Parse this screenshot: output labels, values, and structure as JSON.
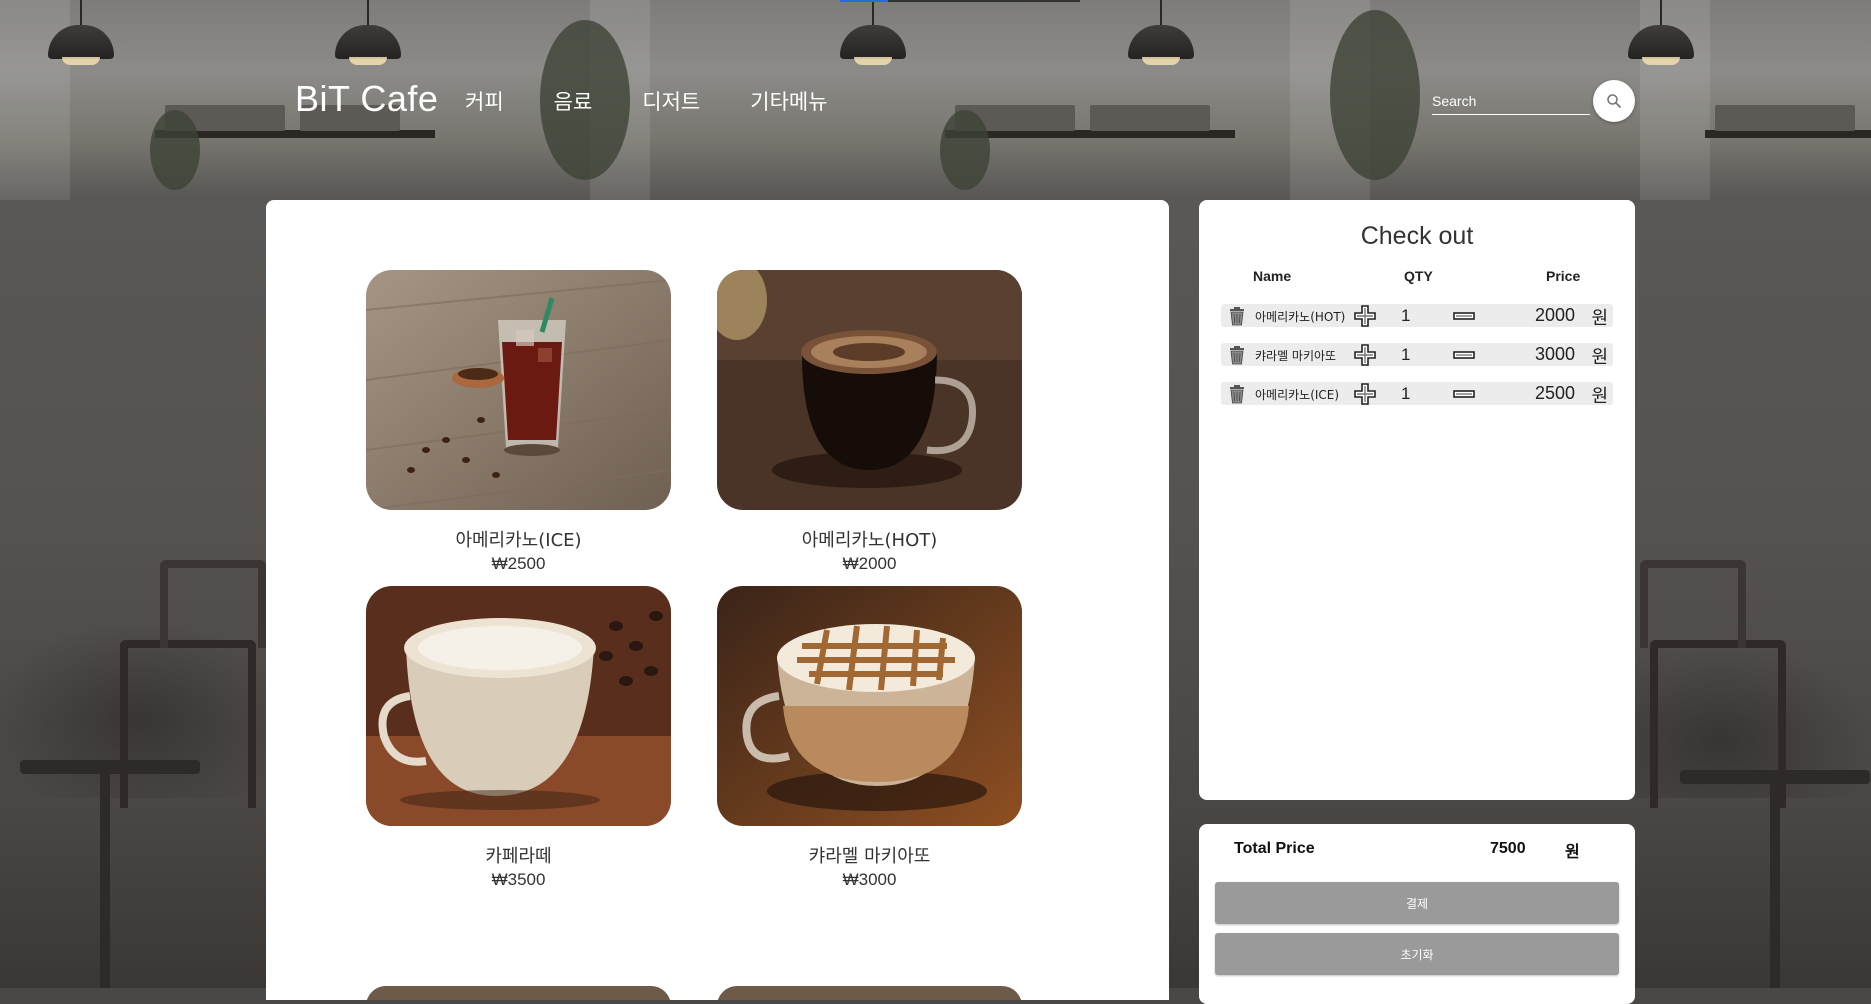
{
  "header": {
    "brand": "BiT Cafe",
    "nav": [
      "커피",
      "음료",
      "디저트",
      "기타메뉴"
    ],
    "search_placeholder": "Search"
  },
  "menu": {
    "items": [
      {
        "name": "아메리카노(ICE)",
        "price": "₩2500"
      },
      {
        "name": "아메리카노(HOT)",
        "price": "₩2000"
      },
      {
        "name": "카페라떼",
        "price": "₩3500"
      },
      {
        "name": "캬라멜 마키아또",
        "price": "₩3000"
      }
    ]
  },
  "checkout": {
    "title": "Check out",
    "col_name": "Name",
    "col_qty": "QTY",
    "col_price": "Price",
    "rows": [
      {
        "name": "아메리카노(HOT)",
        "qty": "1",
        "price": "2000",
        "unit": "원"
      },
      {
        "name": "캬라멜 마키아또",
        "qty": "1",
        "price": "3000",
        "unit": "원"
      },
      {
        "name": "아메리카노(ICE)",
        "qty": "1",
        "price": "2500",
        "unit": "원"
      }
    ]
  },
  "total": {
    "label": "Total Price",
    "value": "7500",
    "unit": "원",
    "pay_button": "결제",
    "reset_button": "초기화"
  }
}
